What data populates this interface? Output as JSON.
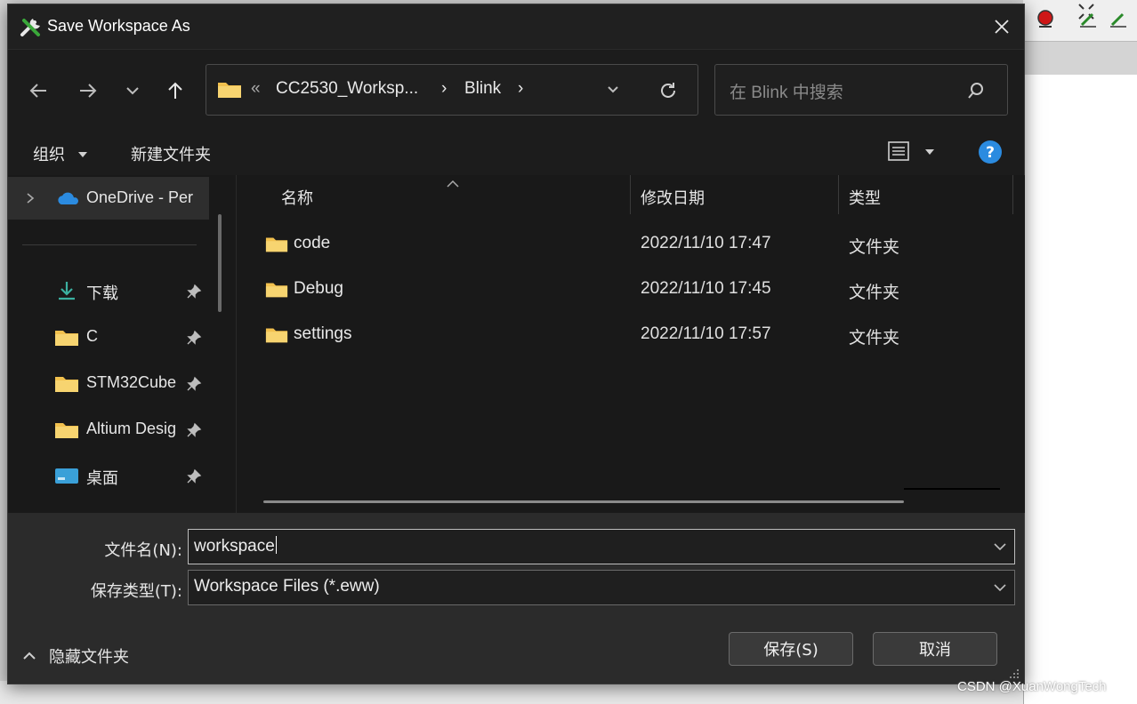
{
  "dialog": {
    "title": "Save Workspace As"
  },
  "address": {
    "overflow": "«",
    "crumbs": [
      "CC2530_Worksp...",
      "Blink"
    ]
  },
  "search": {
    "placeholder": "在 Blink 中搜索"
  },
  "commandbar": {
    "organize": "组织",
    "new_folder": "新建文件夹"
  },
  "navpane": {
    "items": [
      {
        "label": "OneDrive - Per",
        "icon": "onedrive-icon"
      },
      {
        "label": "下载",
        "icon": "download-icon",
        "pinned": true
      },
      {
        "label": "C",
        "icon": "folder-icon",
        "pinned": true
      },
      {
        "label": "STM32Cube",
        "icon": "folder-icon",
        "pinned": true
      },
      {
        "label": "Altium Desig",
        "icon": "folder-icon",
        "pinned": true
      },
      {
        "label": "桌面",
        "icon": "desktop-icon",
        "pinned": true
      }
    ]
  },
  "filelist": {
    "columns": [
      "名称",
      "修改日期",
      "类型"
    ],
    "rows": [
      {
        "name": "code",
        "date": "2022/11/10 17:47",
        "type": "文件夹"
      },
      {
        "name": "Debug",
        "date": "2022/11/10 17:45",
        "type": "文件夹"
      },
      {
        "name": "settings",
        "date": "2022/11/10 17:57",
        "type": "文件夹"
      }
    ]
  },
  "form": {
    "filename_label": "文件名(N):",
    "filename_value": "workspace",
    "filetype_label": "保存类型(T):",
    "filetype_value": "Workspace Files (*.eww)"
  },
  "footer": {
    "hide_folders": "隐藏文件夹",
    "save": "保存(S)",
    "cancel": "取消"
  },
  "watermark": "CSDN @XuanWongTech",
  "colors": {
    "folder": "#f2c14e",
    "accent_blue": "#2b8be0",
    "dialog_bg": "#202020"
  }
}
